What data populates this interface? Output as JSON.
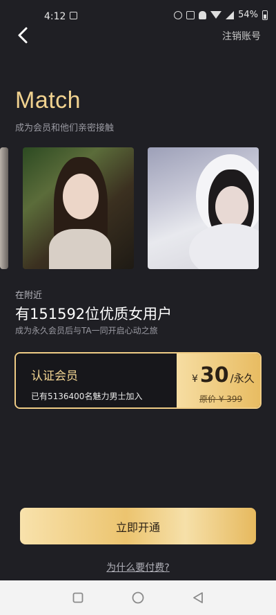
{
  "status_bar": {
    "time": "4:12",
    "battery": "54%",
    "icons": [
      "image-icon",
      "alarm-icon",
      "save-icon",
      "mute-icon",
      "wifi-icon",
      "signal-icon",
      "battery-icon"
    ]
  },
  "header": {
    "back_icon": "chevron-left-icon",
    "logout_label": "注销账号"
  },
  "hero": {
    "title": "Match",
    "subtitle": "成为会员和他们亲密接触"
  },
  "profiles": [
    {
      "name": "profile-photo-partial"
    },
    {
      "name": "profile-photo-1"
    },
    {
      "name": "profile-photo-2"
    }
  ],
  "stats": {
    "nearby_label": "在附近",
    "headline": "有151592位优质女用户",
    "subline": "成为永久会员后与TA一同开启心动之旅"
  },
  "membership": {
    "title": "认证会员",
    "description": "已有5136400名魅力男士加入",
    "currency": "¥",
    "price": "30",
    "unit": "/永久",
    "original_price": "原价 ¥ 399"
  },
  "cta": {
    "label": "立即开通"
  },
  "why_link": "为什么要付费?",
  "colors": {
    "background": "#1f1f24",
    "gold": "#f1d28f",
    "card_dark": "#17171b",
    "nav_bar": "#f3f3f3"
  },
  "nav_bar": {
    "icons": [
      "recent-apps-icon",
      "home-icon",
      "back-triangle-icon"
    ]
  }
}
